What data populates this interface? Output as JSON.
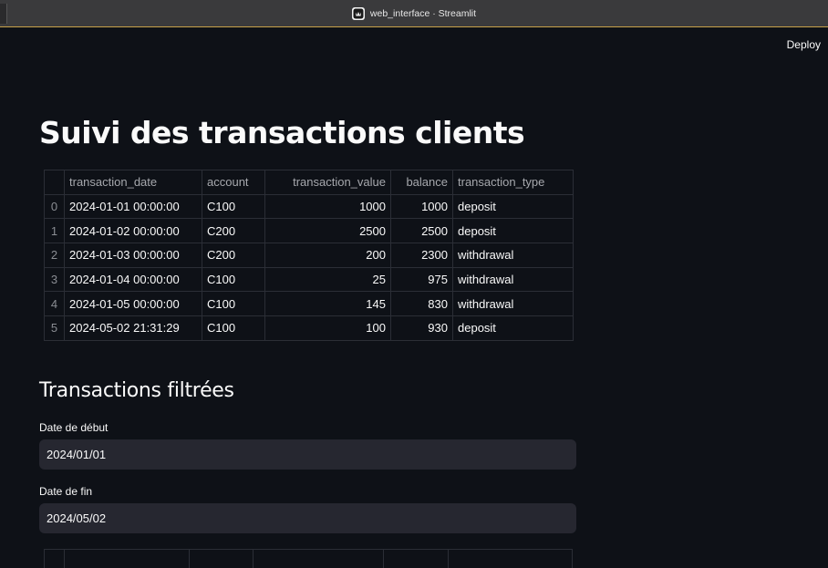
{
  "window": {
    "title": "web_interface · Streamlit",
    "app_icon": "streamlit-crown-icon"
  },
  "header": {
    "deploy_label": "Deploy"
  },
  "page": {
    "title": "Suivi des transactions clients"
  },
  "table": {
    "columns": [
      "",
      "transaction_date",
      "account",
      "transaction_value",
      "balance",
      "transaction_type"
    ],
    "rows": [
      [
        "0",
        "2024-01-01 00:00:00",
        "C100",
        "1000",
        "1000",
        "deposit"
      ],
      [
        "1",
        "2024-01-02 00:00:00",
        "C200",
        "2500",
        "2500",
        "deposit"
      ],
      [
        "2",
        "2024-01-03 00:00:00",
        "C200",
        "200",
        "2300",
        "withdrawal"
      ],
      [
        "3",
        "2024-01-04 00:00:00",
        "C100",
        "25",
        "975",
        "withdrawal"
      ],
      [
        "4",
        "2024-01-05 00:00:00",
        "C100",
        "145",
        "830",
        "withdrawal"
      ],
      [
        "5",
        "2024-05-02 21:31:29",
        "C100",
        "100",
        "930",
        "deposit"
      ]
    ]
  },
  "filter": {
    "section_title": "Transactions filtrées",
    "start_label": "Date de début",
    "start_value": "2024/01/01",
    "end_label": "Date de fin",
    "end_value": "2024/05/02"
  },
  "colors": {
    "background": "#0e1117",
    "input_background": "#262730",
    "title_bar": "#3a3a3c",
    "accent_line": "#c8a24a"
  }
}
